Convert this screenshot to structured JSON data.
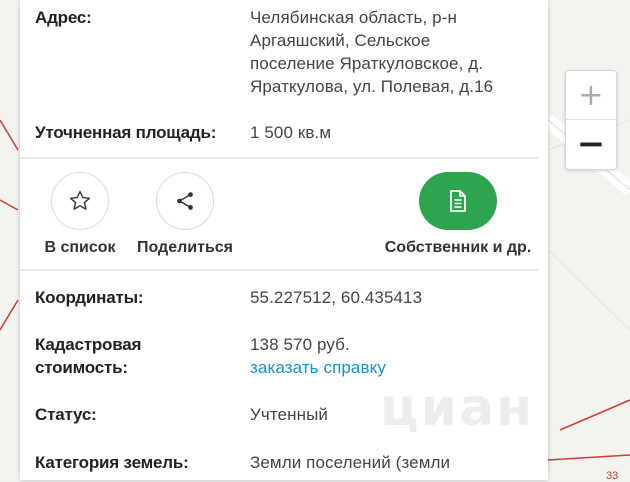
{
  "details_top": [
    {
      "label": "Адрес:",
      "value_lines": [
        "Челябинская область, р-н",
        "Аргаяшский, Сельское",
        "поселение Яраткуловское, д.",
        "Яраткулова, ул. Полевая, д.16"
      ]
    },
    {
      "label": "Уточненная площадь:",
      "value_lines": [
        "1 500 кв.м"
      ]
    }
  ],
  "actions": {
    "favorite_label": "В список",
    "share_label": "Поделиться",
    "owner_label": "Собственник и др.",
    "favorite_icon": "star-icon",
    "share_icon": "share-icon",
    "owner_icon": "document-icon",
    "owner_color": "#2da44e"
  },
  "details_bottom": [
    {
      "label": "Координаты:",
      "value": "55.227512, 60.435413"
    },
    {
      "label_lines": [
        "Кадастровая",
        "стоимость:"
      ],
      "value": "138 570 руб.",
      "link": "заказать справку"
    },
    {
      "label": "Статус:",
      "value": "Учтенный"
    },
    {
      "label": "Категория земель:",
      "value": "Земли поселений (земли"
    }
  ],
  "map": {
    "zoom_in": "+",
    "zoom_out": "−",
    "watermark": "циан",
    "corner_number": "33"
  },
  "colors": {
    "link": "#1a8fc9",
    "accent_green": "#2da44e"
  }
}
